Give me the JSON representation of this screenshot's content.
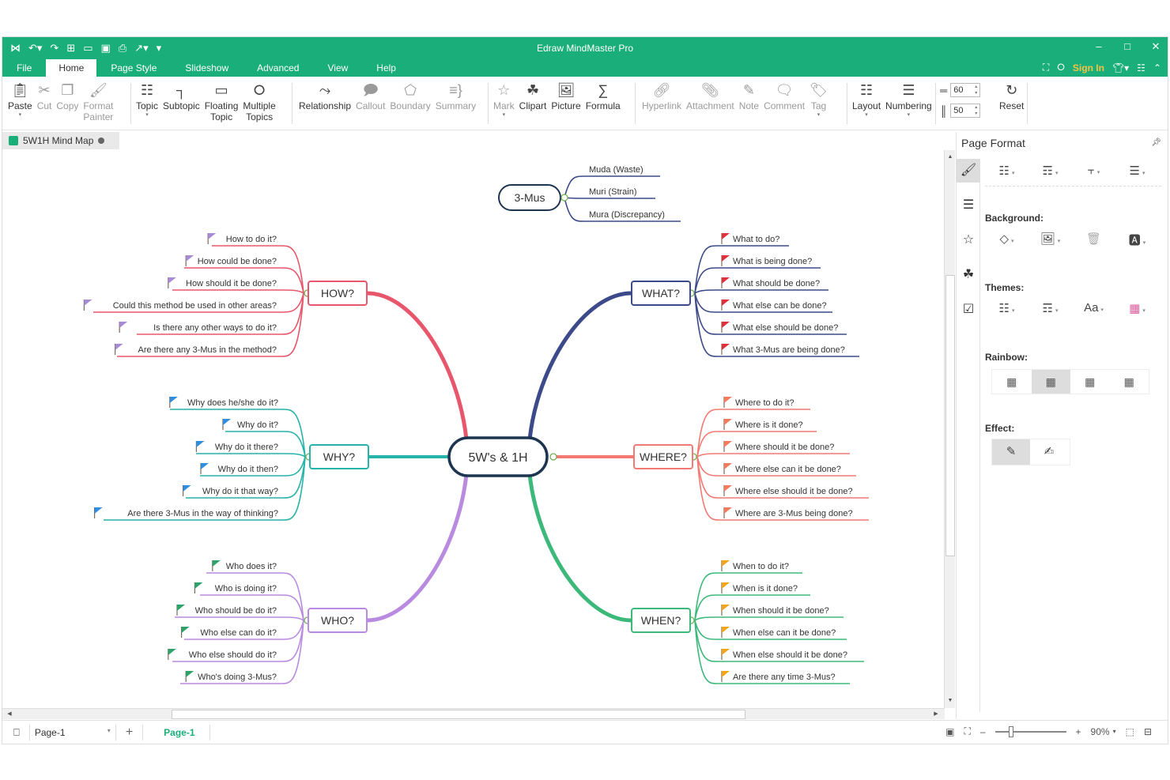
{
  "window": {
    "title": "Edraw MindMaster Pro",
    "quick_access": [
      "logo-icon",
      "undo-icon",
      "redo-icon",
      "new-icon",
      "open-icon",
      "save-icon",
      "print-icon",
      "export-icon",
      "customize-icon"
    ],
    "controls": {
      "minimize": "–",
      "maximize": "□",
      "close": "✕"
    }
  },
  "menu": {
    "tabs": [
      "File",
      "Home",
      "Page Style",
      "Slideshow",
      "Advanced",
      "View",
      "Help"
    ],
    "active_tab": "Home",
    "sign_in": "Sign In"
  },
  "ribbon": {
    "clipboard": [
      {
        "label": "Paste",
        "icon": "paste-icon",
        "enabled": true,
        "dropdown": true
      },
      {
        "label": "Cut",
        "icon": "cut-icon",
        "enabled": false
      },
      {
        "label": "Copy",
        "icon": "copy-icon",
        "enabled": false
      },
      {
        "label": "Format\nPainter",
        "icon": "format-painter-icon",
        "enabled": false
      }
    ],
    "insert": [
      {
        "label": "Topic",
        "icon": "topic-icon",
        "enabled": true,
        "dropdown": true
      },
      {
        "label": "Subtopic",
        "icon": "subtopic-icon",
        "enabled": true
      },
      {
        "label": "Floating\nTopic",
        "icon": "floating-topic-icon",
        "enabled": true
      },
      {
        "label": "Multiple\nTopics",
        "icon": "multiple-topics-icon",
        "enabled": true
      }
    ],
    "relations": [
      {
        "label": "Relationship",
        "icon": "relationship-icon",
        "enabled": true
      },
      {
        "label": "Callout",
        "icon": "callout-icon",
        "enabled": false
      },
      {
        "label": "Boundary",
        "icon": "boundary-icon",
        "enabled": false
      },
      {
        "label": "Summary",
        "icon": "summary-icon",
        "enabled": false
      }
    ],
    "media": [
      {
        "label": "Mark",
        "icon": "mark-icon",
        "enabled": false,
        "dropdown": true
      },
      {
        "label": "Clipart",
        "icon": "clipart-icon",
        "enabled": true
      },
      {
        "label": "Picture",
        "icon": "picture-icon",
        "enabled": true
      },
      {
        "label": "Formula",
        "icon": "formula-icon",
        "enabled": true
      }
    ],
    "links": [
      {
        "label": "Hyperlink",
        "icon": "hyperlink-icon",
        "enabled": false
      },
      {
        "label": "Attachment",
        "icon": "attachment-icon",
        "enabled": false
      },
      {
        "label": "Note",
        "icon": "note-icon",
        "enabled": false
      },
      {
        "label": "Comment",
        "icon": "comment-icon",
        "enabled": false
      },
      {
        "label": "Tag",
        "icon": "tag-icon",
        "enabled": false,
        "dropdown": true
      }
    ],
    "layout": [
      {
        "label": "Layout",
        "icon": "layout-icon",
        "enabled": true,
        "dropdown": true
      },
      {
        "label": "Numbering",
        "icon": "numbering-icon",
        "enabled": true,
        "dropdown": true
      }
    ],
    "spacing": {
      "horizontal": "60",
      "vertical": "50",
      "reset_label": "Reset"
    }
  },
  "document_tab": {
    "name": "5W1H Mind Map"
  },
  "mindmap": {
    "central": "5W's & 1H",
    "floating": {
      "label": "3-Mus",
      "children": [
        "Muda  (Waste)",
        "Muri  (Strain)",
        "Mura  (Discrepancy)"
      ],
      "color": "#3d4a8a"
    },
    "branches": [
      {
        "label": "HOW?",
        "side": "left",
        "color": "#e8566b",
        "flag_color": "#a88bd6",
        "children": [
          "How to do it?",
          "How could be done?",
          "How should it be done?",
          "Could this method be used in other areas?",
          "Is there any other ways to do it?",
          "Are there any 3-Mus in the method?"
        ]
      },
      {
        "label": "WHY?",
        "side": "left",
        "color": "#26b3a9",
        "flag_color": "#2f8ee0",
        "children": [
          "Why does he/she do it?",
          "Why do it?",
          "Why do it there?",
          "Why do it then?",
          "Why do it that way?",
          "Are there 3-Mus in the way of thinking?"
        ]
      },
      {
        "label": "WHO?",
        "side": "left",
        "color": "#b98be0",
        "flag_color": "#2da36b",
        "children": [
          "Who does it?",
          "Who is doing it?",
          "Who should be do it?",
          "Who else can do it?",
          "Who else should do it?",
          "Who's doing 3-Mus?"
        ]
      },
      {
        "label": "WHAT?",
        "side": "right",
        "color": "#3d4a8a",
        "flag_color": "#e2303a",
        "children": [
          "What to do?",
          "What is being done?",
          "What should be done?",
          "What else can be done?",
          "What else should be done?",
          "What 3-Mus are being done?"
        ]
      },
      {
        "label": "WHERE?",
        "side": "right",
        "color": "#f27a72",
        "flag_color": "#f27a5e",
        "children": [
          "Where to do it?",
          "Where is it done?",
          "Where should it be done?",
          "Where  else can it be done?",
          "Where  else should it be done?",
          "Where are 3-Mus being done?"
        ]
      },
      {
        "label": "WHEN?",
        "side": "right",
        "color": "#3cb97a",
        "flag_color": "#f4a418",
        "children": [
          "When to do it?",
          "When is it done?",
          "When should it be done?",
          "When else can it be done?",
          "When  else should it be done?",
          "Are there any time 3-Mus?"
        ]
      }
    ]
  },
  "panel": {
    "title": "Page Format",
    "sections": {
      "background": "Background:",
      "themes": "Themes:",
      "rainbow": "Rainbow:",
      "effect": "Effect:"
    },
    "rainbow_selected": 2,
    "effect_selected": 1
  },
  "statusbar": {
    "page_select": "Page-1",
    "page_tab": "Page-1",
    "zoom": "90%",
    "zoom_fraction": 0.2
  }
}
